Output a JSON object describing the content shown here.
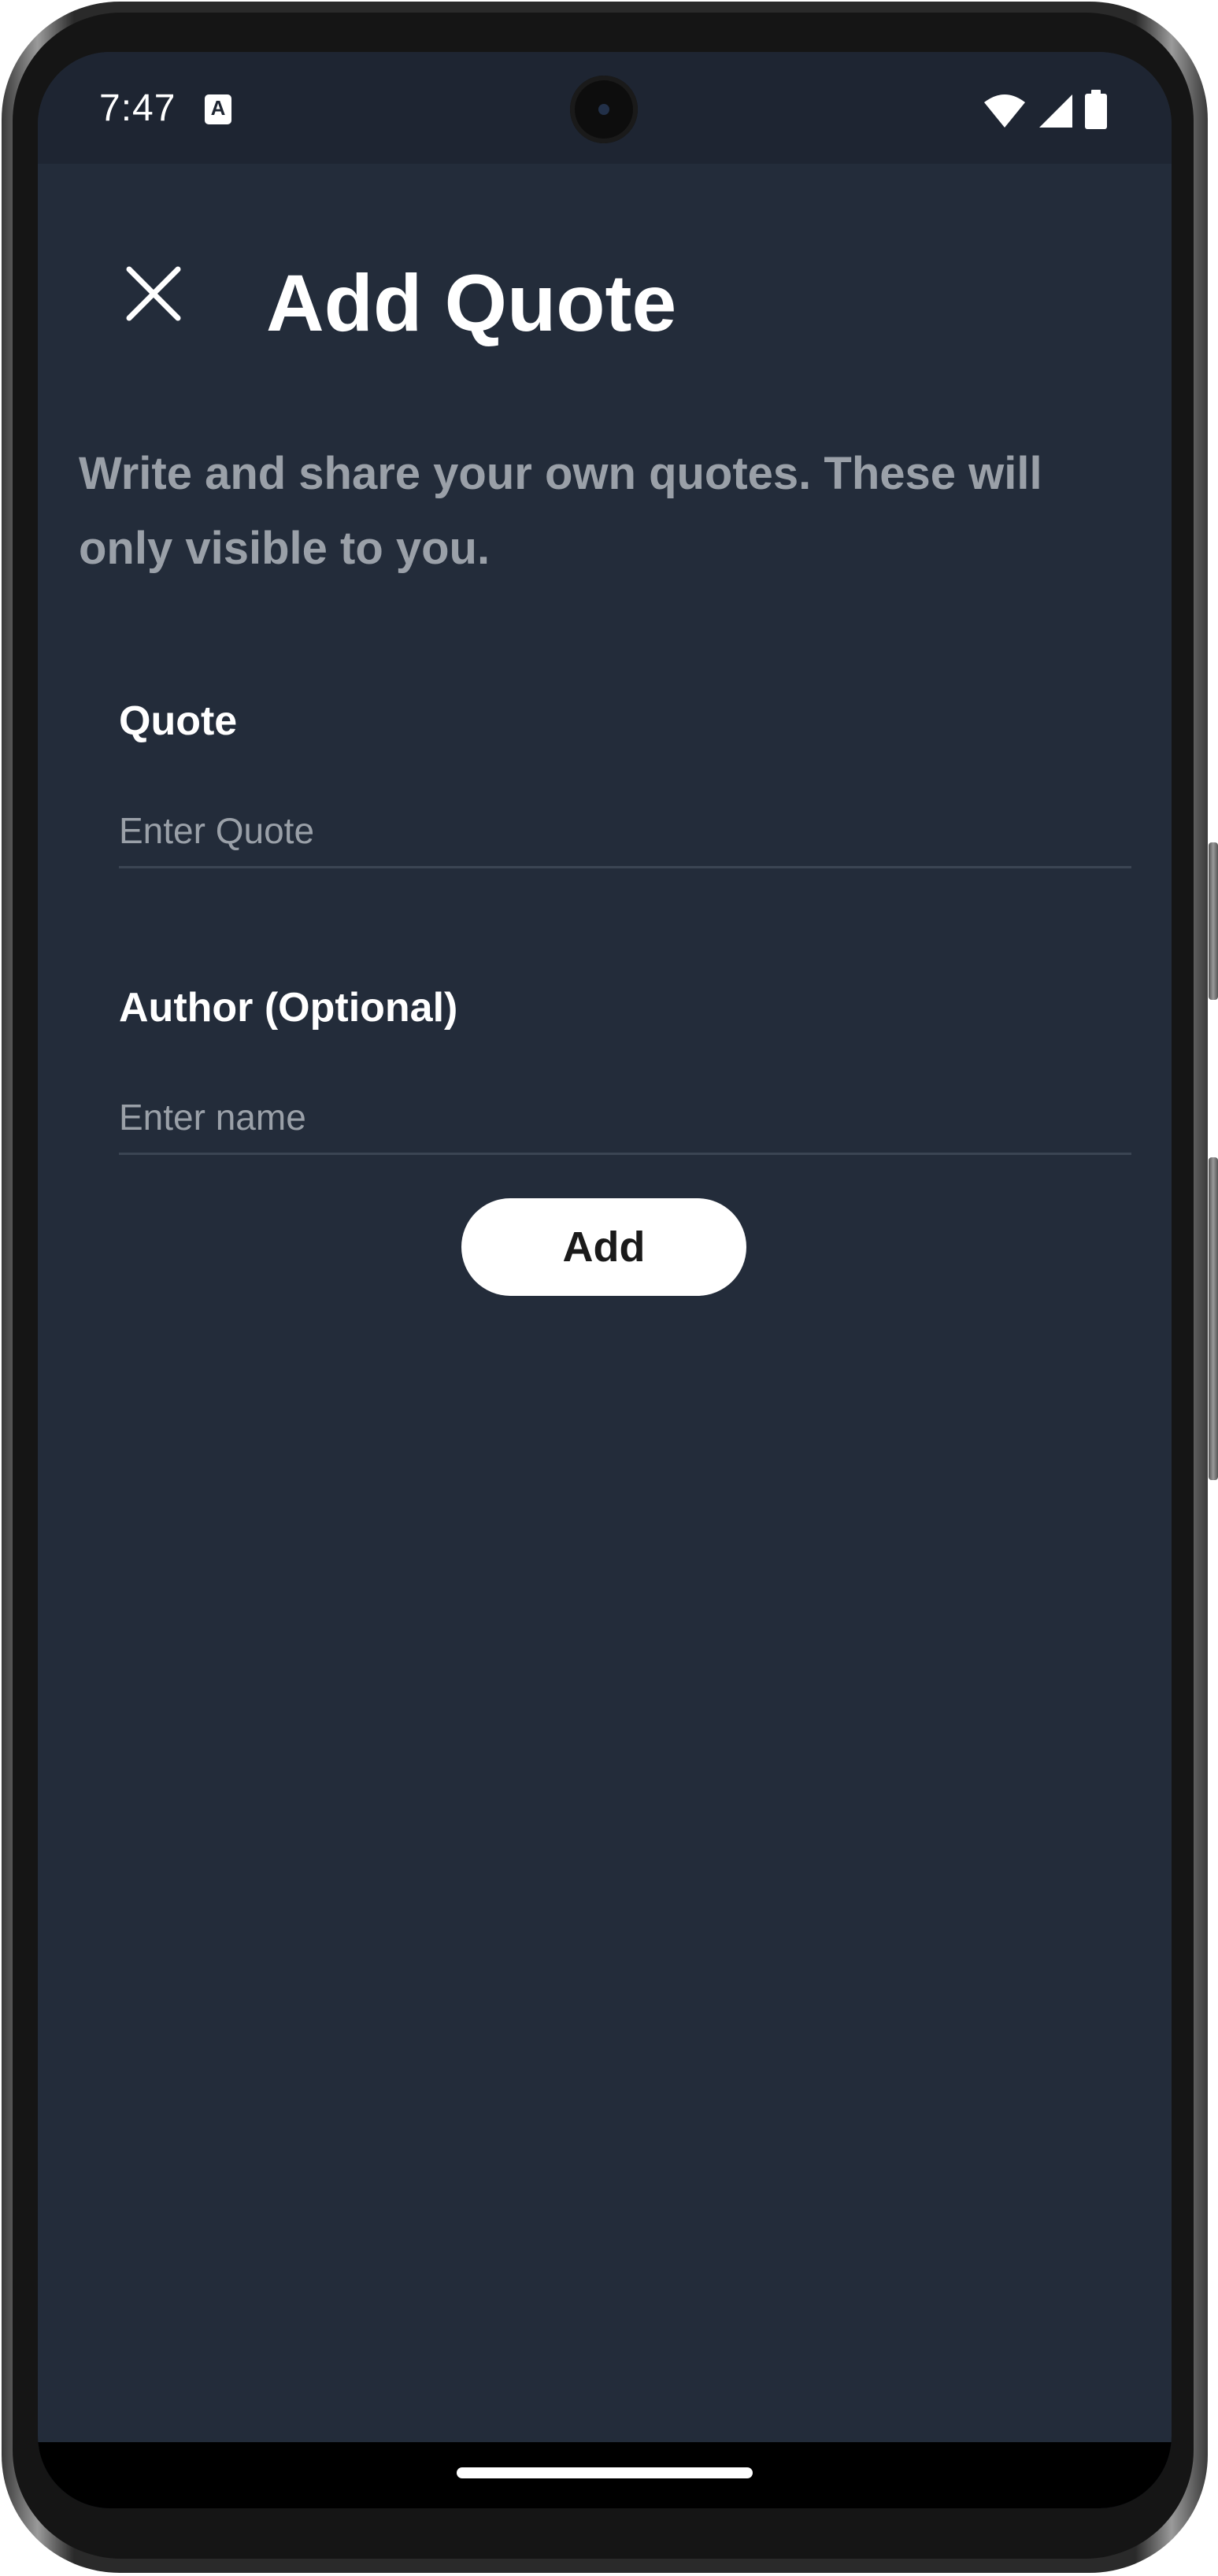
{
  "status_bar": {
    "time": "7:47",
    "notification_icon": "a-badge-icon",
    "icons": [
      "wifi-icon",
      "signal-icon",
      "battery-icon"
    ]
  },
  "header": {
    "title": "Add Quote",
    "close_icon": "close-icon"
  },
  "description": "Write and share your own quotes. These will only visible to you.",
  "form": {
    "quote_label": "Quote",
    "quote_placeholder": "Enter Quote",
    "quote_value": "",
    "author_label": "Author (Optional)",
    "author_placeholder": "Enter name",
    "author_value": "",
    "submit_label": "Add"
  },
  "colors": {
    "background": "#232c3a",
    "status_bar": "#1e2532",
    "muted_text": "#9aa0a8",
    "button": "#ffffff"
  }
}
